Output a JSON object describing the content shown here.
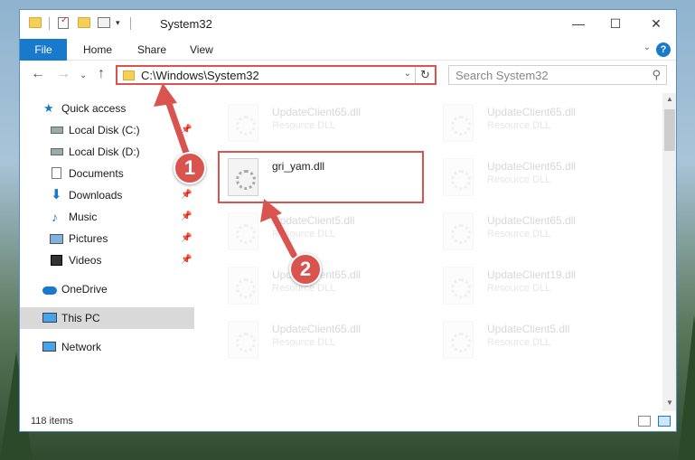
{
  "window": {
    "title": "System32",
    "controls": {
      "minimize": "—",
      "maximize": "☐",
      "close": "✕"
    }
  },
  "ribbon": {
    "tabs": [
      "File",
      "Home",
      "Share",
      "View"
    ],
    "help": "?"
  },
  "navbar": {
    "address": "C:\\Windows\\System32",
    "search_placeholder": "Search System32"
  },
  "sidebar": {
    "items": [
      {
        "label": "Quick access",
        "icon": "star-icon",
        "pinned": false
      },
      {
        "label": "Local Disk (C:)",
        "icon": "drive-icon",
        "pinned": true
      },
      {
        "label": "Local Disk (D:)",
        "icon": "drive-icon",
        "pinned": false
      },
      {
        "label": "Documents",
        "icon": "document-icon",
        "pinned": true
      },
      {
        "label": "Downloads",
        "icon": "download-icon",
        "pinned": true
      },
      {
        "label": "Music",
        "icon": "music-icon",
        "pinned": true
      },
      {
        "label": "Pictures",
        "icon": "picture-icon",
        "pinned": true
      },
      {
        "label": "Videos",
        "icon": "video-icon",
        "pinned": true
      },
      {
        "label": "OneDrive",
        "icon": "cloud-icon",
        "pinned": false
      },
      {
        "label": "This PC",
        "icon": "computer-icon",
        "pinned": false,
        "selected": true
      },
      {
        "label": "Network",
        "icon": "network-icon",
        "pinned": false
      }
    ]
  },
  "files": [
    {
      "name": "UpdateClient65.dll",
      "type": "Resource DLL",
      "faded": true
    },
    {
      "name": "UpdateClient65.dll",
      "type": "Resource DLL",
      "faded": true
    },
    {
      "name": "gri_yam.dll",
      "type": "",
      "faded": false,
      "highlighted": true
    },
    {
      "name": "UpdateClient65.dll",
      "type": "Resource DLL",
      "faded": true
    },
    {
      "name": "UpdateClient5.dll",
      "type": "Resource DLL",
      "faded": true
    },
    {
      "name": "UpdateClient65.dll",
      "type": "Resource DLL",
      "faded": true
    },
    {
      "name": "UpdateClient65.dll",
      "type": "Resource DLL",
      "faded": true
    },
    {
      "name": "UpdateClient19.dll",
      "type": "Resource DLL",
      "faded": true
    },
    {
      "name": "UpdateClient65.dll",
      "type": "Resource DLL",
      "faded": true
    },
    {
      "name": "UpdateClient5.dll",
      "type": "Resource DLL",
      "faded": true
    }
  ],
  "status": {
    "item_count": "118 items"
  },
  "annotations": {
    "step1": "1",
    "step2": "2"
  },
  "colors": {
    "accent": "#1979ca",
    "annotation": "#d9534f"
  }
}
